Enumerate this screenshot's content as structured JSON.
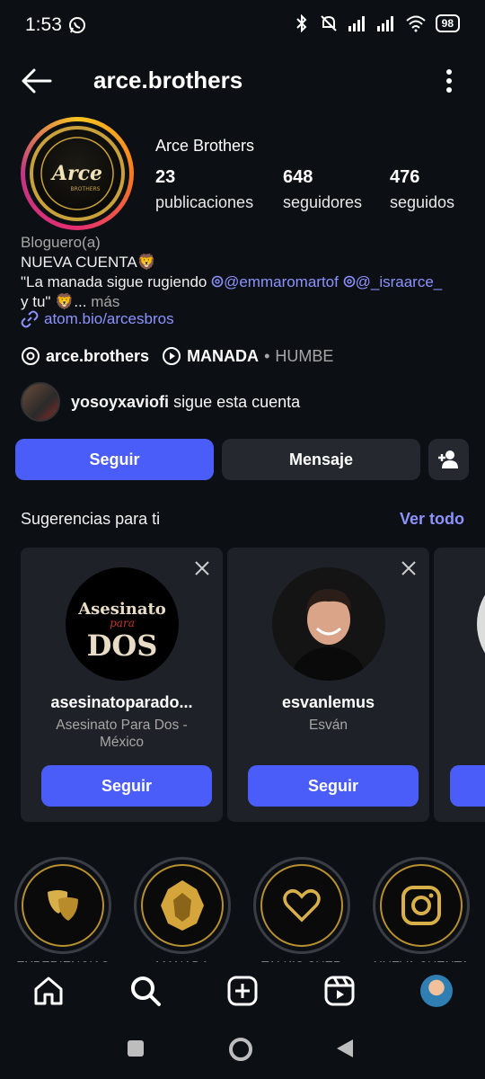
{
  "status": {
    "time": "1:53",
    "battery": "98"
  },
  "header": {
    "username": "arce.brothers"
  },
  "profile": {
    "name": "Arce Brothers",
    "avatar_text": "Arce",
    "avatar_subtext": "BROTHERS",
    "stats": [
      {
        "num": "23",
        "label": "publicaciones"
      },
      {
        "num": "648",
        "label": "seguidores"
      },
      {
        "num": "476",
        "label": "seguidos"
      }
    ]
  },
  "bio": {
    "category": "Bloguero(a)",
    "line1": "NUEVA CUENTA🦁",
    "line2_prefix": "\"La manada sigue rugiendo ",
    "mention1": "@emmaromartof",
    "mention2": "@_israarce_",
    "line3": "y tu\" 🦁...",
    "more": "más",
    "link": "atom.bio/arcesbros"
  },
  "links": {
    "threads": "arce.brothers",
    "music_title": "MANADA",
    "music_sep": "•",
    "music_artist": "HUMBE"
  },
  "followed_by": {
    "user": "yosoyxaviofi",
    "text": "sigue esta cuenta"
  },
  "buttons": {
    "follow": "Seguir",
    "message": "Mensaje"
  },
  "suggestions": {
    "title": "Sugerencias para ti",
    "see_all": "Ver todo",
    "items": [
      {
        "user": "asesinatoparado...",
        "name": "Asesinato Para Dos - México",
        "button": "Seguir",
        "art_line1": "Asesinato",
        "art_line2": "para",
        "art_line3": "DOS"
      },
      {
        "user": "esvanlemus",
        "name": "Esván",
        "button": "Seguir"
      }
    ]
  },
  "highlights": [
    {
      "label": "EXPERIENCIAS",
      "icon": "theater-masks-icon"
    },
    {
      "label": "MANADA",
      "icon": "lion-icon"
    },
    {
      "label": "TALKIS SUER",
      "icon": "heart-icon"
    },
    {
      "label": "NUEVA CUENTA",
      "icon": "instagram-icon"
    }
  ],
  "colors": {
    "accent": "#4a5df9",
    "link": "#8c93ff",
    "gold": "#c9a13a",
    "bg": "#0c0f14",
    "card": "#1e2127"
  }
}
